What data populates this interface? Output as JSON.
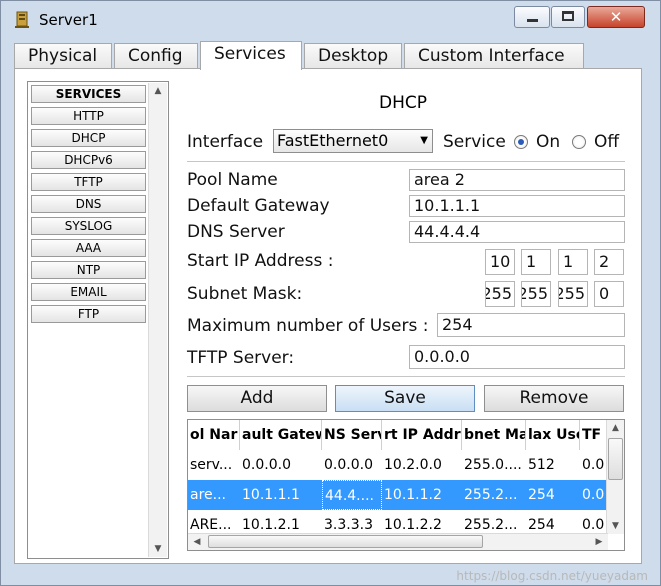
{
  "window": {
    "title": "Server1"
  },
  "tabs": [
    "Physical",
    "Config",
    "Services",
    "Desktop",
    "Custom Interface"
  ],
  "active_tab": "Services",
  "services": {
    "header": "SERVICES",
    "items": [
      "HTTP",
      "DHCP",
      "DHCPv6",
      "TFTP",
      "DNS",
      "SYSLOG",
      "AAA",
      "NTP",
      "EMAIL",
      "FTP"
    ]
  },
  "dhcp": {
    "title": "DHCP",
    "interface_label": "Interface",
    "interface_value": "FastEthernet0",
    "service_label": "Service",
    "on_label": "On",
    "off_label": "Off",
    "service_state": "On",
    "pool_name_label": "Pool Name",
    "pool_name_value": "area 2",
    "gateway_label": "Default Gateway",
    "gateway_value": "10.1.1.1",
    "dns_label": "DNS Server",
    "dns_value": "44.4.4.4",
    "start_ip_label": "Start IP Address :",
    "start_ip": [
      "10",
      "1",
      "1",
      "2"
    ],
    "subnet_label": "Subnet Mask:",
    "subnet": [
      "255",
      "255",
      "255",
      "0"
    ],
    "max_users_label": "Maximum number of Users :",
    "max_users_value": "254",
    "tftp_label": "TFTP Server:",
    "tftp_value": "0.0.0.0"
  },
  "buttons": {
    "add": "Add",
    "save": "Save",
    "remove": "Remove"
  },
  "table": {
    "headers": [
      "ol Nar",
      "ault Gatew",
      "NS Serv",
      "rt IP Addr",
      "bnet Ma",
      "lax Use",
      "TF"
    ],
    "rows": [
      [
        "serv...",
        "0.0.0.0",
        "0.0.0.0",
        "10.2.0.0",
        "255.0....",
        "512",
        "0.0"
      ],
      [
        "are...",
        "10.1.1.1",
        "44.4....",
        "10.1.1.2",
        "255.2...",
        "254",
        "0.0"
      ],
      [
        "ARE...",
        "10.1.2.1",
        "3.3.3.3",
        "10.1.2.2",
        "255.2...",
        "254",
        "0.0"
      ]
    ],
    "selected_row": 1
  },
  "watermark": "https://blog.csdn.net/yueyadam"
}
